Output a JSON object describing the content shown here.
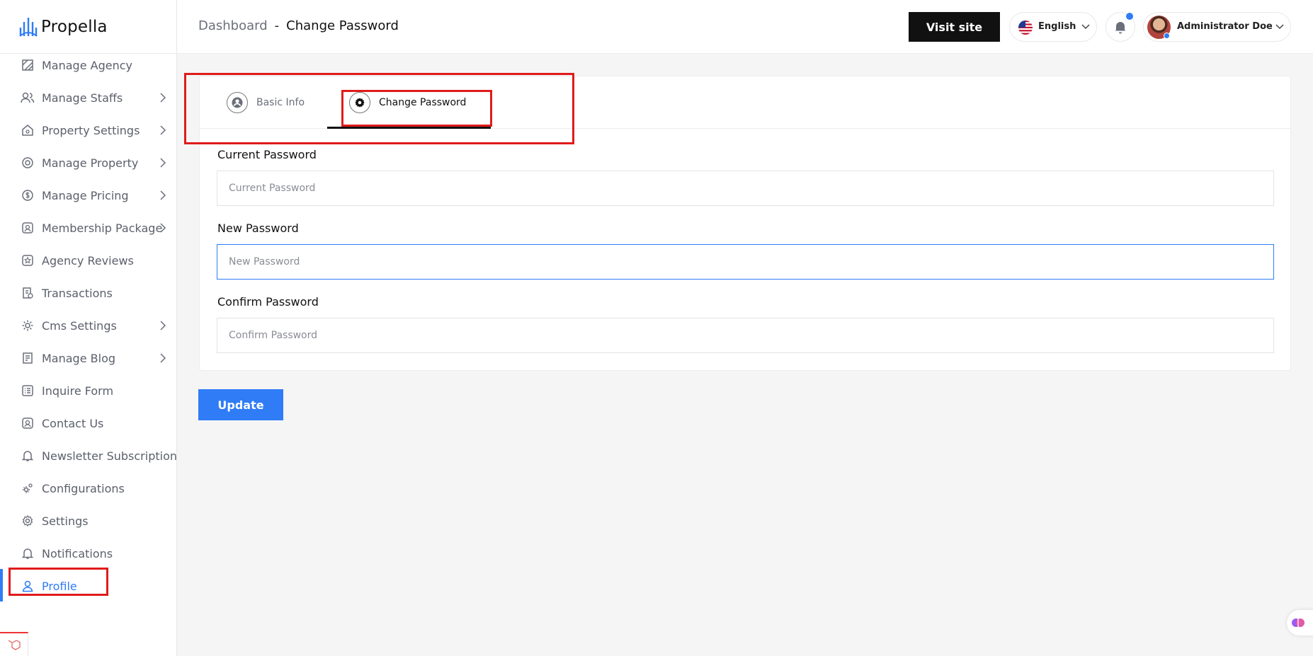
{
  "app": {
    "name": "Propella"
  },
  "sidebar": {
    "items": [
      {
        "label": "Manage Agency",
        "icon": "agency-icon",
        "has_children": false
      },
      {
        "label": "Manage Staffs",
        "icon": "users-icon",
        "has_children": true
      },
      {
        "label": "Property Settings",
        "icon": "house-settings-icon",
        "has_children": true
      },
      {
        "label": "Manage Property",
        "icon": "property-icon",
        "has_children": true
      },
      {
        "label": "Manage Pricing",
        "icon": "pricing-icon",
        "has_children": true
      },
      {
        "label": "Membership Package",
        "icon": "membership-icon",
        "has_children": true
      },
      {
        "label": "Agency Reviews",
        "icon": "star-icon",
        "has_children": false
      },
      {
        "label": "Transactions",
        "icon": "receipt-icon",
        "has_children": false
      },
      {
        "label": "Cms Settings",
        "icon": "cms-gear-icon",
        "has_children": true
      },
      {
        "label": "Manage Blog",
        "icon": "blog-icon",
        "has_children": true
      },
      {
        "label": "Inquire Form",
        "icon": "form-list-icon",
        "has_children": false
      },
      {
        "label": "Contact Us",
        "icon": "contact-icon",
        "has_children": false
      },
      {
        "label": "Newsletter Subscription",
        "icon": "bell-icon",
        "has_children": false
      },
      {
        "label": "Configurations",
        "icon": "configurations-icon",
        "has_children": false
      },
      {
        "label": "Settings",
        "icon": "gear-icon",
        "has_children": false
      },
      {
        "label": "Notifications",
        "icon": "bell-icon",
        "has_children": false
      },
      {
        "label": "Profile",
        "icon": "user-icon",
        "has_children": false,
        "active": true
      }
    ]
  },
  "header": {
    "breadcrumb": {
      "parent": "Dashboard",
      "separator": "-",
      "current": "Change Password"
    },
    "visit_site_label": "Visit site",
    "language": {
      "selected": "English",
      "flag": "us-flag-icon"
    },
    "user": {
      "name": "Administrator Doe"
    }
  },
  "tabs": {
    "basic_info": "Basic Info",
    "change_password": "Change Password",
    "active": "change_password"
  },
  "form": {
    "current_password": {
      "label": "Current Password",
      "placeholder": "Current Password",
      "value": ""
    },
    "new_password": {
      "label": "New Password",
      "placeholder": "New Password",
      "value": ""
    },
    "confirm_password": {
      "label": "Confirm Password",
      "placeholder": "Confirm Password",
      "value": ""
    },
    "submit_label": "Update"
  },
  "colors": {
    "accent": "#2f7cf6",
    "highlight_box": "#e01b1b",
    "dark_button": "#111111"
  }
}
